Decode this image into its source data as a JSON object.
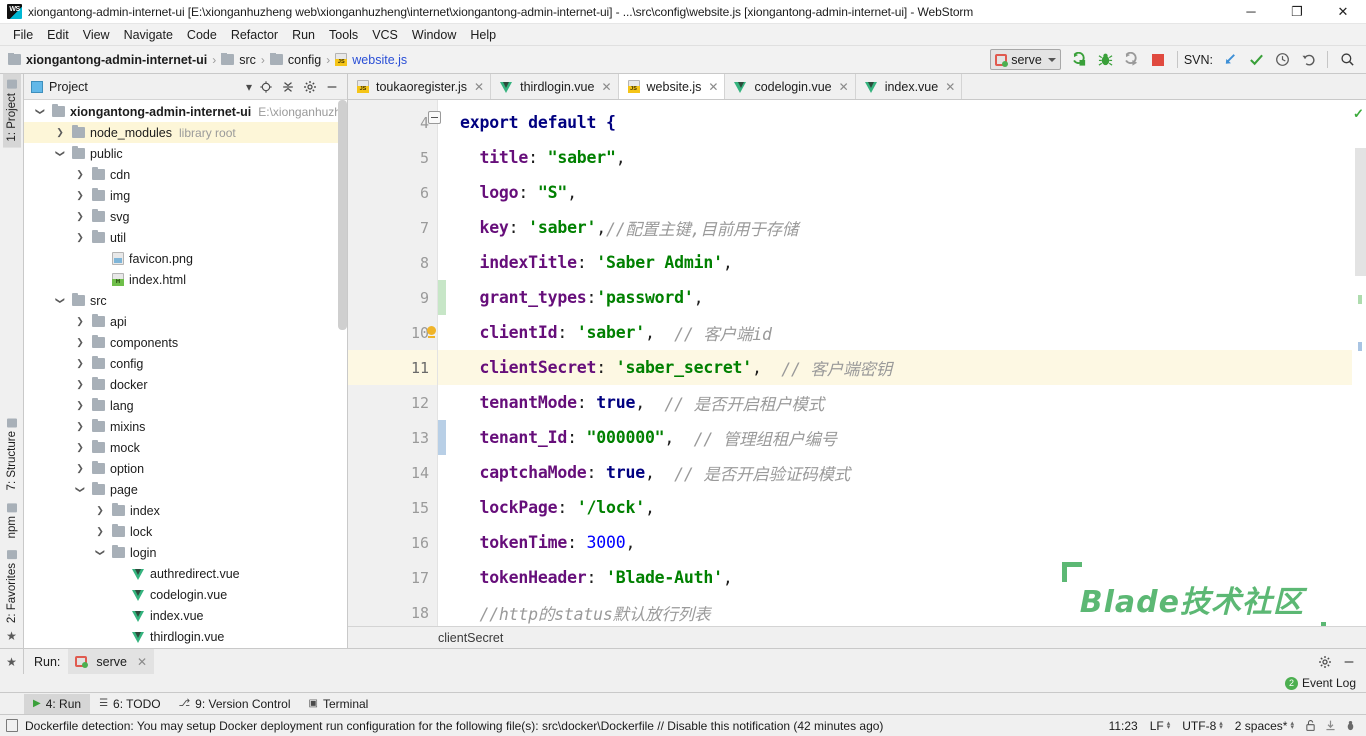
{
  "window": {
    "title": "xiongantong-admin-internet-ui [E:\\xionganhuzheng web\\xionganhuzheng\\internet\\xiongantong-admin-internet-ui] - ...\\src\\config\\website.js [xiongantong-admin-internet-ui] - WebStorm",
    "app_logo": "webstorm-logo",
    "minimize": "─",
    "maximize": "❐",
    "close": "✕"
  },
  "menu": [
    {
      "label": "File"
    },
    {
      "label": "Edit"
    },
    {
      "label": "View"
    },
    {
      "label": "Navigate"
    },
    {
      "label": "Code"
    },
    {
      "label": "Refactor"
    },
    {
      "label": "Run"
    },
    {
      "label": "Tools"
    },
    {
      "label": "VCS"
    },
    {
      "label": "Window"
    },
    {
      "label": "Help"
    }
  ],
  "toolbar": {
    "breadcrumbs": [
      {
        "label": "xiongantong-admin-internet-ui",
        "icon": "folder-icon",
        "bold": true
      },
      {
        "label": "src",
        "icon": "folder-icon",
        "bold": false
      },
      {
        "label": "config",
        "icon": "folder-icon",
        "bold": false
      },
      {
        "label": "website.js",
        "icon": "js-file-icon",
        "bold": false,
        "link": true
      }
    ],
    "separator": "›",
    "run_config": "serve",
    "run_button": "run-icon",
    "debug_button": "debug-icon",
    "coverage_button": "run-with-coverage-icon",
    "stop_button": "stop-icon",
    "svn_label": "SVN:",
    "svn_update": "update-icon",
    "svn_commit": "commit-icon",
    "svn_history": "history-icon",
    "svn_rollback": "rollback-icon",
    "search_button": "search-icon"
  },
  "left_strip": [
    {
      "label": "1: Project",
      "icon": "project-icon",
      "active": true
    },
    {
      "label": "7: Structure",
      "icon": "structure-icon",
      "active": false
    },
    {
      "label": "npm",
      "icon": "npm-icon",
      "active": false
    },
    {
      "label": "2: Favorites",
      "icon": "favorites-icon",
      "active": false
    }
  ],
  "project_panel": {
    "title": "Project",
    "dropdown": "▾",
    "locate_icon": "locate-icon",
    "collapse_icon": "collapse-all-icon",
    "settings_icon": "gear-icon",
    "hide_icon": "hide-icon",
    "tree": [
      {
        "indent": 0,
        "arrow": "open",
        "icon": "folder-icon",
        "label": "xiongantong-admin-internet-ui",
        "bold": true,
        "path": "E:\\xionganhuzh",
        "hl": false
      },
      {
        "indent": 1,
        "arrow": "closed",
        "icon": "folder-icon",
        "label": "node_modules",
        "sub": "library root",
        "hl": true
      },
      {
        "indent": 1,
        "arrow": "open",
        "icon": "folder-icon",
        "label": "public",
        "hl": false
      },
      {
        "indent": 2,
        "arrow": "closed",
        "icon": "folder-icon",
        "label": "cdn",
        "hl": false
      },
      {
        "indent": 2,
        "arrow": "closed",
        "icon": "folder-icon",
        "label": "img",
        "hl": false
      },
      {
        "indent": 2,
        "arrow": "closed",
        "icon": "folder-icon",
        "label": "svg",
        "hl": false
      },
      {
        "indent": 2,
        "arrow": "closed",
        "icon": "folder-icon",
        "label": "util",
        "hl": false
      },
      {
        "indent": 3,
        "arrow": "none",
        "icon": "png-file-icon",
        "label": "favicon.png",
        "hl": false
      },
      {
        "indent": 3,
        "arrow": "none",
        "icon": "html-file-icon",
        "label": "index.html",
        "hl": false
      },
      {
        "indent": 1,
        "arrow": "open",
        "icon": "folder-icon",
        "label": "src",
        "hl": false
      },
      {
        "indent": 2,
        "arrow": "closed",
        "icon": "folder-icon",
        "label": "api",
        "hl": false
      },
      {
        "indent": 2,
        "arrow": "closed",
        "icon": "folder-icon",
        "label": "components",
        "hl": false
      },
      {
        "indent": 2,
        "arrow": "closed",
        "icon": "folder-icon",
        "label": "config",
        "hl": false
      },
      {
        "indent": 2,
        "arrow": "closed",
        "icon": "folder-icon",
        "label": "docker",
        "hl": false
      },
      {
        "indent": 2,
        "arrow": "closed",
        "icon": "folder-icon",
        "label": "lang",
        "hl": false
      },
      {
        "indent": 2,
        "arrow": "closed",
        "icon": "folder-icon",
        "label": "mixins",
        "hl": false
      },
      {
        "indent": 2,
        "arrow": "closed",
        "icon": "folder-icon",
        "label": "mock",
        "hl": false
      },
      {
        "indent": 2,
        "arrow": "closed",
        "icon": "folder-icon",
        "label": "option",
        "hl": false
      },
      {
        "indent": 2,
        "arrow": "open",
        "icon": "folder-icon",
        "label": "page",
        "hl": false
      },
      {
        "indent": 3,
        "arrow": "closed",
        "icon": "folder-icon",
        "label": "index",
        "hl": false
      },
      {
        "indent": 3,
        "arrow": "closed",
        "icon": "folder-icon",
        "label": "lock",
        "hl": false
      },
      {
        "indent": 3,
        "arrow": "open",
        "icon": "folder-icon",
        "label": "login",
        "hl": false
      },
      {
        "indent": 4,
        "arrow": "none",
        "icon": "vue-file-icon",
        "label": "authredirect.vue",
        "hl": false
      },
      {
        "indent": 4,
        "arrow": "none",
        "icon": "vue-file-icon",
        "label": "codelogin.vue",
        "hl": false
      },
      {
        "indent": 4,
        "arrow": "none",
        "icon": "vue-file-icon",
        "label": "index.vue",
        "hl": false
      },
      {
        "indent": 4,
        "arrow": "none",
        "icon": "vue-file-icon",
        "label": "thirdlogin.vue",
        "hl": false
      }
    ]
  },
  "editor_tabs": [
    {
      "label": "toukaoregister.js",
      "icon": "js-file-icon",
      "active": false,
      "close": "✕"
    },
    {
      "label": "thirdlogin.vue",
      "icon": "vue-file-icon",
      "active": false,
      "close": "✕"
    },
    {
      "label": "website.js",
      "icon": "js-file-icon",
      "active": true,
      "close": "✕"
    },
    {
      "label": "codelogin.vue",
      "icon": "vue-file-icon",
      "active": false,
      "close": "✕"
    },
    {
      "label": "index.vue",
      "icon": "vue-file-icon",
      "active": false,
      "close": "✕"
    }
  ],
  "editor": {
    "breadcrumb": "clientSecret",
    "inspection_status": "ok-check-icon",
    "lines": [
      {
        "num": "4",
        "current": false,
        "fold": true,
        "bulb": false,
        "marker": "",
        "tokens": [
          {
            "t": "export default {",
            "c": "k-kw"
          }
        ]
      },
      {
        "num": "5",
        "current": false,
        "fold": false,
        "bulb": false,
        "marker": "",
        "tokens": [
          {
            "t": "  title",
            "c": "k-key"
          },
          {
            "t": ": ",
            "c": "k-pl"
          },
          {
            "t": "\"saber\"",
            "c": "k-str"
          },
          {
            "t": ",",
            "c": "k-pl"
          }
        ]
      },
      {
        "num": "6",
        "current": false,
        "fold": false,
        "bulb": false,
        "marker": "",
        "tokens": [
          {
            "t": "  logo",
            "c": "k-key"
          },
          {
            "t": ": ",
            "c": "k-pl"
          },
          {
            "t": "\"S\"",
            "c": "k-str"
          },
          {
            "t": ",",
            "c": "k-pl"
          }
        ]
      },
      {
        "num": "7",
        "current": false,
        "fold": false,
        "bulb": false,
        "marker": "",
        "tokens": [
          {
            "t": "  key",
            "c": "k-key"
          },
          {
            "t": ": ",
            "c": "k-pl"
          },
          {
            "t": "'saber'",
            "c": "k-str"
          },
          {
            "t": ",",
            "c": "k-pl"
          },
          {
            "t": "//配置主键,目前用于存储",
            "c": "k-com"
          }
        ]
      },
      {
        "num": "8",
        "current": false,
        "fold": false,
        "bulb": false,
        "marker": "",
        "tokens": [
          {
            "t": "  indexTitle",
            "c": "k-key"
          },
          {
            "t": ": ",
            "c": "k-pl"
          },
          {
            "t": "'Saber Admin'",
            "c": "k-str"
          },
          {
            "t": ",",
            "c": "k-pl"
          }
        ]
      },
      {
        "num": "9",
        "current": false,
        "fold": false,
        "bulb": false,
        "marker": "green",
        "tokens": [
          {
            "t": "  grant_types",
            "c": "k-key"
          },
          {
            "t": ":",
            "c": "k-pl"
          },
          {
            "t": "'password'",
            "c": "k-str"
          },
          {
            "t": ",",
            "c": "k-pl"
          }
        ]
      },
      {
        "num": "10",
        "current": false,
        "fold": false,
        "bulb": true,
        "marker": "",
        "tokens": [
          {
            "t": "  clientId",
            "c": "k-key"
          },
          {
            "t": ": ",
            "c": "k-pl"
          },
          {
            "t": "'saber'",
            "c": "k-str"
          },
          {
            "t": ",  ",
            "c": "k-pl"
          },
          {
            "t": "// 客户端id",
            "c": "k-com"
          }
        ]
      },
      {
        "num": "11",
        "current": true,
        "fold": false,
        "bulb": false,
        "marker": "",
        "tokens": [
          {
            "t": "  clientSecret",
            "c": "k-key"
          },
          {
            "t": ": ",
            "c": "k-pl"
          },
          {
            "t": "'saber_secret'",
            "c": "k-str"
          },
          {
            "t": ",  ",
            "c": "k-pl"
          },
          {
            "t": "// 客户端密钥",
            "c": "k-com"
          }
        ]
      },
      {
        "num": "12",
        "current": false,
        "fold": false,
        "bulb": false,
        "marker": "",
        "tokens": [
          {
            "t": "  tenantMode",
            "c": "k-key"
          },
          {
            "t": ": ",
            "c": "k-pl"
          },
          {
            "t": "true",
            "c": "k-kw"
          },
          {
            "t": ",  ",
            "c": "k-pl"
          },
          {
            "t": "// 是否开启租户模式",
            "c": "k-com"
          }
        ]
      },
      {
        "num": "13",
        "current": false,
        "fold": false,
        "bulb": false,
        "marker": "blue",
        "tokens": [
          {
            "t": "  tenant_Id",
            "c": "k-key"
          },
          {
            "t": ": ",
            "c": "k-pl"
          },
          {
            "t": "\"000000\"",
            "c": "k-str"
          },
          {
            "t": ",  ",
            "c": "k-pl"
          },
          {
            "t": "// 管理组租户编号",
            "c": "k-com"
          }
        ]
      },
      {
        "num": "14",
        "current": false,
        "fold": false,
        "bulb": false,
        "marker": "",
        "tokens": [
          {
            "t": "  captchaMode",
            "c": "k-key"
          },
          {
            "t": ": ",
            "c": "k-pl"
          },
          {
            "t": "true",
            "c": "k-kw"
          },
          {
            "t": ",  ",
            "c": "k-pl"
          },
          {
            "t": "// 是否开启验证码模式",
            "c": "k-com"
          }
        ]
      },
      {
        "num": "15",
        "current": false,
        "fold": false,
        "bulb": false,
        "marker": "",
        "tokens": [
          {
            "t": "  lockPage",
            "c": "k-key"
          },
          {
            "t": ": ",
            "c": "k-pl"
          },
          {
            "t": "'/lock'",
            "c": "k-str"
          },
          {
            "t": ",",
            "c": "k-pl"
          }
        ]
      },
      {
        "num": "16",
        "current": false,
        "fold": false,
        "bulb": false,
        "marker": "",
        "tokens": [
          {
            "t": "  tokenTime",
            "c": "k-key"
          },
          {
            "t": ": ",
            "c": "k-pl"
          },
          {
            "t": "3000",
            "c": "k-num"
          },
          {
            "t": ",",
            "c": "k-pl"
          }
        ]
      },
      {
        "num": "17",
        "current": false,
        "fold": false,
        "bulb": false,
        "marker": "",
        "tokens": [
          {
            "t": "  tokenHeader",
            "c": "k-key"
          },
          {
            "t": ": ",
            "c": "k-pl"
          },
          {
            "t": "'Blade-Auth'",
            "c": "k-str"
          },
          {
            "t": ",",
            "c": "k-pl"
          }
        ]
      },
      {
        "num": "18",
        "current": false,
        "fold": false,
        "bulb": false,
        "marker": "",
        "tokens": [
          {
            "t": "  //http的status默认放行列表",
            "c": "k-com"
          }
        ]
      }
    ],
    "watermark": "Blade技术社区"
  },
  "run_window": {
    "label": "Run:",
    "tab": "serve",
    "tab_close": "✕",
    "settings_icon": "gear-icon",
    "hide_icon": "hide-icon",
    "event_log": "Event Log",
    "event_count": "2",
    "favorites_icon": "star-icon"
  },
  "tool_window_bar": [
    {
      "label": "4: Run",
      "icon": "run-icon",
      "active": true
    },
    {
      "label": "6: TODO",
      "icon": "todo-icon",
      "active": false
    },
    {
      "label": "9: Version Control",
      "icon": "vcs-icon",
      "active": false
    },
    {
      "label": "Terminal",
      "icon": "terminal-icon",
      "active": false
    }
  ],
  "statusbar": {
    "notification_icon": "notification-icon",
    "message": "Dockerfile detection: You may setup Docker deployment run configuration for the following file(s): src\\docker\\Dockerfile // Disable this notification (42 minutes ago)",
    "time": "11:23",
    "line_separator": "LF",
    "encoding": "UTF-8",
    "indent": "2 spaces*",
    "lock_icon": "unlocked-icon",
    "download_icon": "download-icon",
    "inspector_icon": "inspector-icon"
  },
  "colors": {
    "accent_green": "#5cb874",
    "keyword": "#000080",
    "string": "#008000",
    "property": "#660e7a",
    "comment": "#9a9a9a",
    "number": "#0000ff",
    "current_line": "#fdf8e3",
    "highlight_row": "#fdf6d8"
  }
}
